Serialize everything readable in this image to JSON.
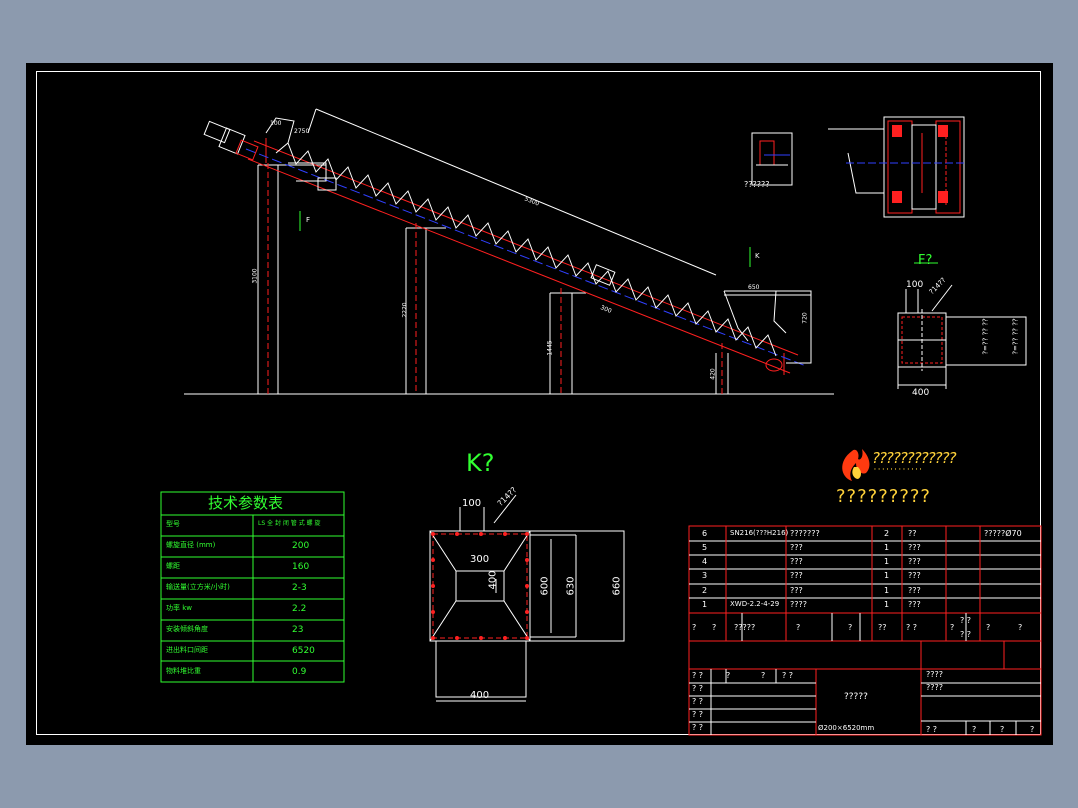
{
  "drawing": {
    "frame_color": "#ffffff",
    "background": "#000000",
    "line_colors": {
      "outline": "#ffffff",
      "red": "#ff2020",
      "blue": "#3040ff",
      "green": "#31ff31",
      "yellow": "#ffd23a"
    }
  },
  "main_view": {
    "dims": {
      "length": "5300",
      "h1": "3100",
      "h2": "2220",
      "h3": "1445",
      "h4": "420",
      "top": "2750",
      "left_top": "100",
      "right_top": "650",
      "right_side": "720",
      "r_low": "300"
    },
    "markers": {
      "F": "F",
      "K": "K"
    }
  },
  "detail_small": {
    "caption": "??????"
  },
  "view_f": {
    "title": "F?",
    "dim_top": "100",
    "dim_bottom": "400",
    "hole_note": "?14?? ",
    "side1": "?=?? ?? ??",
    "side2": "?=?? ?? ??"
  },
  "view_k": {
    "title": "K?",
    "dim_top": "100",
    "hole_note": "?14?? ",
    "d300": "300",
    "d400": "400",
    "d600": "600",
    "d630": "630",
    "d660": "660",
    "d400b": "400"
  },
  "logo": {
    "company": "????????????",
    "dots": "' ' ' ' ' ' ' ' ' ' ' '",
    "subtitle": "?????????"
  },
  "param_table": {
    "title": "技术参数表",
    "rows": [
      {
        "label": "型号",
        "value": "LS 全 封 闭 管 式 螺 旋"
      },
      {
        "label": "螺旋直径 (mm)",
        "value": "200"
      },
      {
        "label": "螺距",
        "value": "160"
      },
      {
        "label": "输送量(立方米/小时)",
        "value": "2-3"
      },
      {
        "label": "功率 kw",
        "value": "2.2"
      },
      {
        "label": "安装倾斜角度",
        "value": "23"
      },
      {
        "label": "进出料口间距",
        "value": "6520"
      },
      {
        "label": "物料堆比重",
        "value": "0.9"
      }
    ]
  },
  "title_block": {
    "parts": [
      {
        "no": "6",
        "code": "SN216(???H216)",
        "name": "???????",
        "qty": "2",
        "mat": "??",
        "note": "?????Ø70"
      },
      {
        "no": "5",
        "code": "",
        "name": "???",
        "qty": "1",
        "mat": "???",
        "note": ""
      },
      {
        "no": "4",
        "code": "",
        "name": "???",
        "qty": "1",
        "mat": "???",
        "note": ""
      },
      {
        "no": "3",
        "code": "",
        "name": "???",
        "qty": "1",
        "mat": "???",
        "note": ""
      },
      {
        "no": "2",
        "code": "",
        "name": "???",
        "qty": "1",
        "mat": "???",
        "note": ""
      },
      {
        "no": "1",
        "code": "XWD-2.2-4-29",
        "name": "????",
        "qty": "1",
        "mat": "???",
        "note": ""
      }
    ],
    "header": {
      "c1": "?",
      "c2": "?",
      "c3": "?????",
      "c4": "?",
      "c5": "?",
      "c6": "??",
      "c7": "? ?",
      "c8": "?",
      "c9": "? ?",
      "c9b": "? ?",
      "c10": "?",
      "c11": "?"
    },
    "sign_rows": [
      "? ?",
      "? ?",
      "? ?",
      "? ?",
      "? ?",
      "? ?"
    ],
    "sign_top": [
      "?",
      "?",
      "? ?"
    ],
    "drawing_name": "?????",
    "spec": "Ø200×6520mm",
    "right_top": [
      "????",
      "????"
    ],
    "bottom_right": [
      "? ?",
      "?",
      "?",
      "?"
    ]
  }
}
